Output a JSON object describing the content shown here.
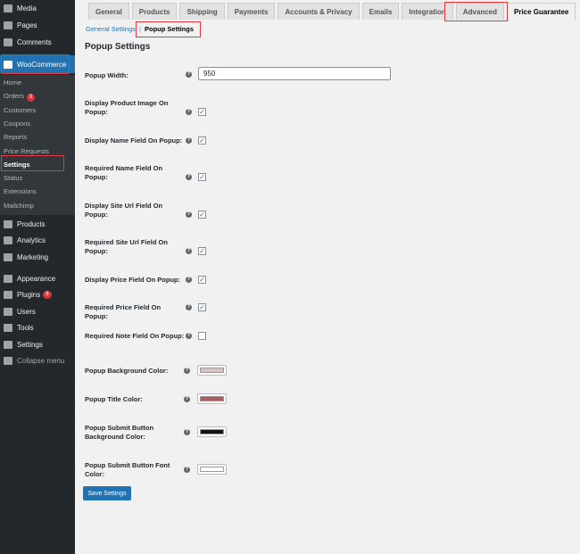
{
  "sidebar": {
    "top": [
      {
        "label": "Media",
        "icon": "media-icon"
      },
      {
        "label": "Pages",
        "icon": "pages-icon"
      },
      {
        "label": "Comments",
        "icon": "comments-icon"
      }
    ],
    "woocommerce": "WooCommerce",
    "submenu": [
      {
        "label": "Home"
      },
      {
        "label": "Orders",
        "badge": "9"
      },
      {
        "label": "Customers"
      },
      {
        "label": "Coupons"
      },
      {
        "label": "Reports"
      },
      {
        "label": "Price Requests"
      },
      {
        "label": "Settings",
        "current": true
      },
      {
        "label": "Status"
      },
      {
        "label": "Extensions"
      },
      {
        "label": "Mailchimp"
      }
    ],
    "bottom": [
      {
        "label": "Products",
        "icon": "products-icon"
      },
      {
        "label": "Analytics",
        "icon": "analytics-icon"
      },
      {
        "label": "Marketing",
        "icon": "marketing-icon"
      },
      {
        "label": "Appearance",
        "icon": "appearance-icon"
      },
      {
        "label": "Plugins",
        "icon": "plugins-icon",
        "badge": "8"
      },
      {
        "label": "Users",
        "icon": "users-icon"
      },
      {
        "label": "Tools",
        "icon": "tools-icon"
      },
      {
        "label": "Settings",
        "icon": "settings-icon"
      },
      {
        "label": "Collapse menu",
        "icon": "collapse-icon"
      }
    ]
  },
  "tabs": [
    "General",
    "Products",
    "Shipping",
    "Payments",
    "Accounts & Privacy",
    "Emails",
    "Integration",
    "Advanced",
    "Price Guarantee"
  ],
  "active_tab": "Price Guarantee",
  "subnav": {
    "general": "General Settings",
    "sep": "|",
    "popup": "Popup Settings"
  },
  "heading": "Popup Settings",
  "popup_width": {
    "label": "Popup Width:",
    "value": "950"
  },
  "checkboxes": [
    {
      "label": "Display Product Image On Popup:",
      "checked": true
    },
    {
      "label": "Display Name Field On Popup:",
      "checked": true
    },
    {
      "label": "Required Name Field On Popup:",
      "checked": true
    },
    {
      "label": "Display Site Url Field On Popup:",
      "checked": true
    },
    {
      "label": "Required Site Url Field On Popup:",
      "checked": true
    },
    {
      "label": "Display Price Field On Popup:",
      "checked": true
    },
    {
      "label": "Required Price Field On Popup:",
      "checked": true
    },
    {
      "label": "Required Note Field On Popup:",
      "checked": false
    }
  ],
  "colors": [
    {
      "label": "Popup Background Color:",
      "color": "#d9c3c3"
    },
    {
      "label": "Popup Title Color:",
      "color": "#b05a5a"
    },
    {
      "label": "Popup Submit Button Background Color:",
      "color": "#111111"
    },
    {
      "label": "Popup Submit Button Font Color:",
      "color": "#ffffff"
    }
  ],
  "save_label": "Save Settings",
  "help_glyph": "?",
  "check_glyph": "✓"
}
